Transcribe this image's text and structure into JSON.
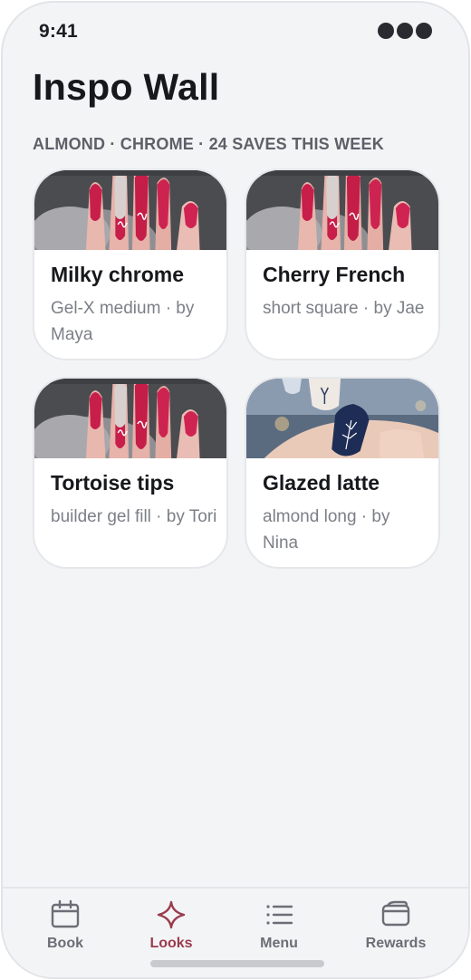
{
  "status_bar": {
    "time": "9:41"
  },
  "header": {
    "title": "Inspo Wall",
    "subtitle": "ALMOND · CHROME · 24 SAVES THIS WEEK"
  },
  "cards": [
    {
      "title": "Milky chrome",
      "meta": "Gel-X medium · by Maya",
      "photo": "red-nails-photo"
    },
    {
      "title": "Cherry French",
      "meta": "short square · by Jae",
      "photo": "red-nails-photo"
    },
    {
      "title": "Tortoise tips",
      "meta": "builder gel fill · by Tori",
      "photo": "red-nails-photo"
    },
    {
      "title": "Glazed latte",
      "meta": "almond long · by Nina",
      "photo": "blue-winter-nails-photo"
    }
  ],
  "tabs": [
    {
      "label": "Book",
      "icon": "calendar-icon",
      "active": false
    },
    {
      "label": "Looks",
      "icon": "sparkle-icon",
      "active": true
    },
    {
      "label": "Menu",
      "icon": "list-icon",
      "active": false
    },
    {
      "label": "Rewards",
      "icon": "wallet-icon",
      "active": false
    }
  ],
  "colors": {
    "accent": "#9b3b4c",
    "background": "#f3f4f6",
    "card": "#ffffff",
    "muted_text": "#7c7f86"
  }
}
